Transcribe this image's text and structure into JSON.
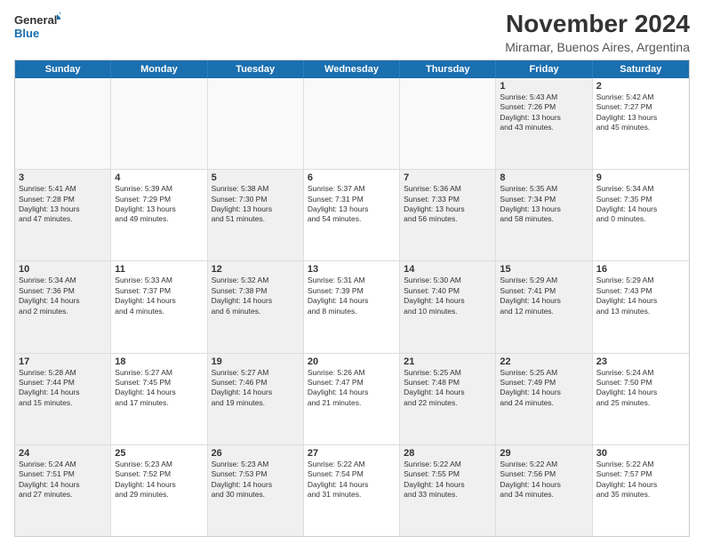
{
  "logo": {
    "line1": "General",
    "line2": "Blue"
  },
  "title": "November 2024",
  "subtitle": "Miramar, Buenos Aires, Argentina",
  "weekdays": [
    "Sunday",
    "Monday",
    "Tuesday",
    "Wednesday",
    "Thursday",
    "Friday",
    "Saturday"
  ],
  "rows": [
    [
      {
        "day": "",
        "text": "",
        "empty": true
      },
      {
        "day": "",
        "text": "",
        "empty": true
      },
      {
        "day": "",
        "text": "",
        "empty": true
      },
      {
        "day": "",
        "text": "",
        "empty": true
      },
      {
        "day": "",
        "text": "",
        "empty": true
      },
      {
        "day": "1",
        "text": "Sunrise: 5:43 AM\nSunset: 7:26 PM\nDaylight: 13 hours\nand 43 minutes.",
        "shaded": true
      },
      {
        "day": "2",
        "text": "Sunrise: 5:42 AM\nSunset: 7:27 PM\nDaylight: 13 hours\nand 45 minutes.",
        "shaded": false
      }
    ],
    [
      {
        "day": "3",
        "text": "Sunrise: 5:41 AM\nSunset: 7:28 PM\nDaylight: 13 hours\nand 47 minutes.",
        "shaded": true
      },
      {
        "day": "4",
        "text": "Sunrise: 5:39 AM\nSunset: 7:29 PM\nDaylight: 13 hours\nand 49 minutes.",
        "shaded": false
      },
      {
        "day": "5",
        "text": "Sunrise: 5:38 AM\nSunset: 7:30 PM\nDaylight: 13 hours\nand 51 minutes.",
        "shaded": true
      },
      {
        "day": "6",
        "text": "Sunrise: 5:37 AM\nSunset: 7:31 PM\nDaylight: 13 hours\nand 54 minutes.",
        "shaded": false
      },
      {
        "day": "7",
        "text": "Sunrise: 5:36 AM\nSunset: 7:33 PM\nDaylight: 13 hours\nand 56 minutes.",
        "shaded": true
      },
      {
        "day": "8",
        "text": "Sunrise: 5:35 AM\nSunset: 7:34 PM\nDaylight: 13 hours\nand 58 minutes.",
        "shaded": true
      },
      {
        "day": "9",
        "text": "Sunrise: 5:34 AM\nSunset: 7:35 PM\nDaylight: 14 hours\nand 0 minutes.",
        "shaded": false
      }
    ],
    [
      {
        "day": "10",
        "text": "Sunrise: 5:34 AM\nSunset: 7:36 PM\nDaylight: 14 hours\nand 2 minutes.",
        "shaded": true
      },
      {
        "day": "11",
        "text": "Sunrise: 5:33 AM\nSunset: 7:37 PM\nDaylight: 14 hours\nand 4 minutes.",
        "shaded": false
      },
      {
        "day": "12",
        "text": "Sunrise: 5:32 AM\nSunset: 7:38 PM\nDaylight: 14 hours\nand 6 minutes.",
        "shaded": true
      },
      {
        "day": "13",
        "text": "Sunrise: 5:31 AM\nSunset: 7:39 PM\nDaylight: 14 hours\nand 8 minutes.",
        "shaded": false
      },
      {
        "day": "14",
        "text": "Sunrise: 5:30 AM\nSunset: 7:40 PM\nDaylight: 14 hours\nand 10 minutes.",
        "shaded": true
      },
      {
        "day": "15",
        "text": "Sunrise: 5:29 AM\nSunset: 7:41 PM\nDaylight: 14 hours\nand 12 minutes.",
        "shaded": true
      },
      {
        "day": "16",
        "text": "Sunrise: 5:29 AM\nSunset: 7:43 PM\nDaylight: 14 hours\nand 13 minutes.",
        "shaded": false
      }
    ],
    [
      {
        "day": "17",
        "text": "Sunrise: 5:28 AM\nSunset: 7:44 PM\nDaylight: 14 hours\nand 15 minutes.",
        "shaded": true
      },
      {
        "day": "18",
        "text": "Sunrise: 5:27 AM\nSunset: 7:45 PM\nDaylight: 14 hours\nand 17 minutes.",
        "shaded": false
      },
      {
        "day": "19",
        "text": "Sunrise: 5:27 AM\nSunset: 7:46 PM\nDaylight: 14 hours\nand 19 minutes.",
        "shaded": true
      },
      {
        "day": "20",
        "text": "Sunrise: 5:26 AM\nSunset: 7:47 PM\nDaylight: 14 hours\nand 21 minutes.",
        "shaded": false
      },
      {
        "day": "21",
        "text": "Sunrise: 5:25 AM\nSunset: 7:48 PM\nDaylight: 14 hours\nand 22 minutes.",
        "shaded": true
      },
      {
        "day": "22",
        "text": "Sunrise: 5:25 AM\nSunset: 7:49 PM\nDaylight: 14 hours\nand 24 minutes.",
        "shaded": true
      },
      {
        "day": "23",
        "text": "Sunrise: 5:24 AM\nSunset: 7:50 PM\nDaylight: 14 hours\nand 25 minutes.",
        "shaded": false
      }
    ],
    [
      {
        "day": "24",
        "text": "Sunrise: 5:24 AM\nSunset: 7:51 PM\nDaylight: 14 hours\nand 27 minutes.",
        "shaded": true
      },
      {
        "day": "25",
        "text": "Sunrise: 5:23 AM\nSunset: 7:52 PM\nDaylight: 14 hours\nand 29 minutes.",
        "shaded": false
      },
      {
        "day": "26",
        "text": "Sunrise: 5:23 AM\nSunset: 7:53 PM\nDaylight: 14 hours\nand 30 minutes.",
        "shaded": true
      },
      {
        "day": "27",
        "text": "Sunrise: 5:22 AM\nSunset: 7:54 PM\nDaylight: 14 hours\nand 31 minutes.",
        "shaded": false
      },
      {
        "day": "28",
        "text": "Sunrise: 5:22 AM\nSunset: 7:55 PM\nDaylight: 14 hours\nand 33 minutes.",
        "shaded": true
      },
      {
        "day": "29",
        "text": "Sunrise: 5:22 AM\nSunset: 7:56 PM\nDaylight: 14 hours\nand 34 minutes.",
        "shaded": true
      },
      {
        "day": "30",
        "text": "Sunrise: 5:22 AM\nSunset: 7:57 PM\nDaylight: 14 hours\nand 35 minutes.",
        "shaded": false
      }
    ]
  ]
}
